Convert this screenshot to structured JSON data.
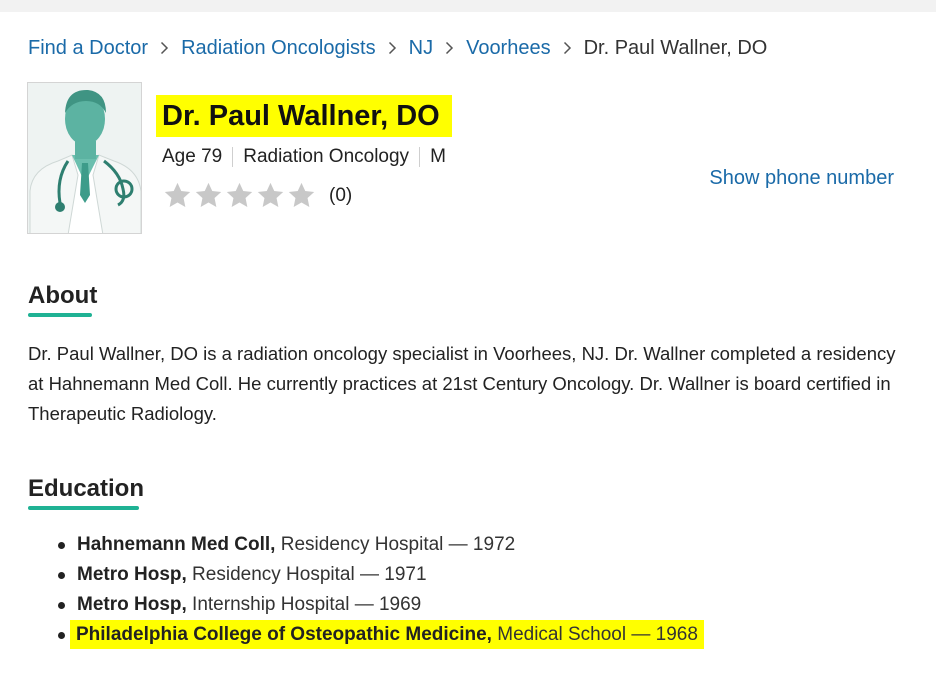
{
  "breadcrumb": [
    {
      "label": "Find a Doctor",
      "link": true
    },
    {
      "label": "Radiation Oncologists",
      "link": true
    },
    {
      "label": "NJ",
      "link": true
    },
    {
      "label": "Voorhees",
      "link": true
    },
    {
      "label": "Dr. Paul Wallner, DO",
      "link": false
    }
  ],
  "doctor": {
    "name": "Dr. Paul Wallner, DO",
    "age": "Age 79",
    "specialty": "Radiation Oncology",
    "gender": "M",
    "rating": 0,
    "rating_max": 5,
    "review_count": "(0)",
    "show_phone": "Show phone number"
  },
  "about": {
    "title": "About",
    "text": "Dr. Paul Wallner, DO is a radiation oncology specialist in Voorhees, NJ. Dr. Wallner completed a residency at Hahnemann Med Coll. He currently practices at 21st Century Oncology. Dr. Wallner is board certified in Therapeutic Radiology."
  },
  "education": {
    "title": "Education",
    "items": [
      {
        "school": "Hahnemann Med Coll,",
        "detail": " Residency Hospital — 1972",
        "highlighted": false
      },
      {
        "school": "Metro Hosp,",
        "detail": " Residency Hospital — 1971",
        "highlighted": false
      },
      {
        "school": "Metro Hosp,",
        "detail": " Internship Hospital — 1969",
        "highlighted": false
      },
      {
        "school": "Philadelphia College of Osteopathic Medicine,",
        "detail": " Medical School — 1968",
        "highlighted": true
      }
    ]
  },
  "colors": {
    "link": "#1a6aa8",
    "accent_underline": "#1fb294",
    "highlight": "#ffff00",
    "star_empty": "#c8c8c8"
  }
}
